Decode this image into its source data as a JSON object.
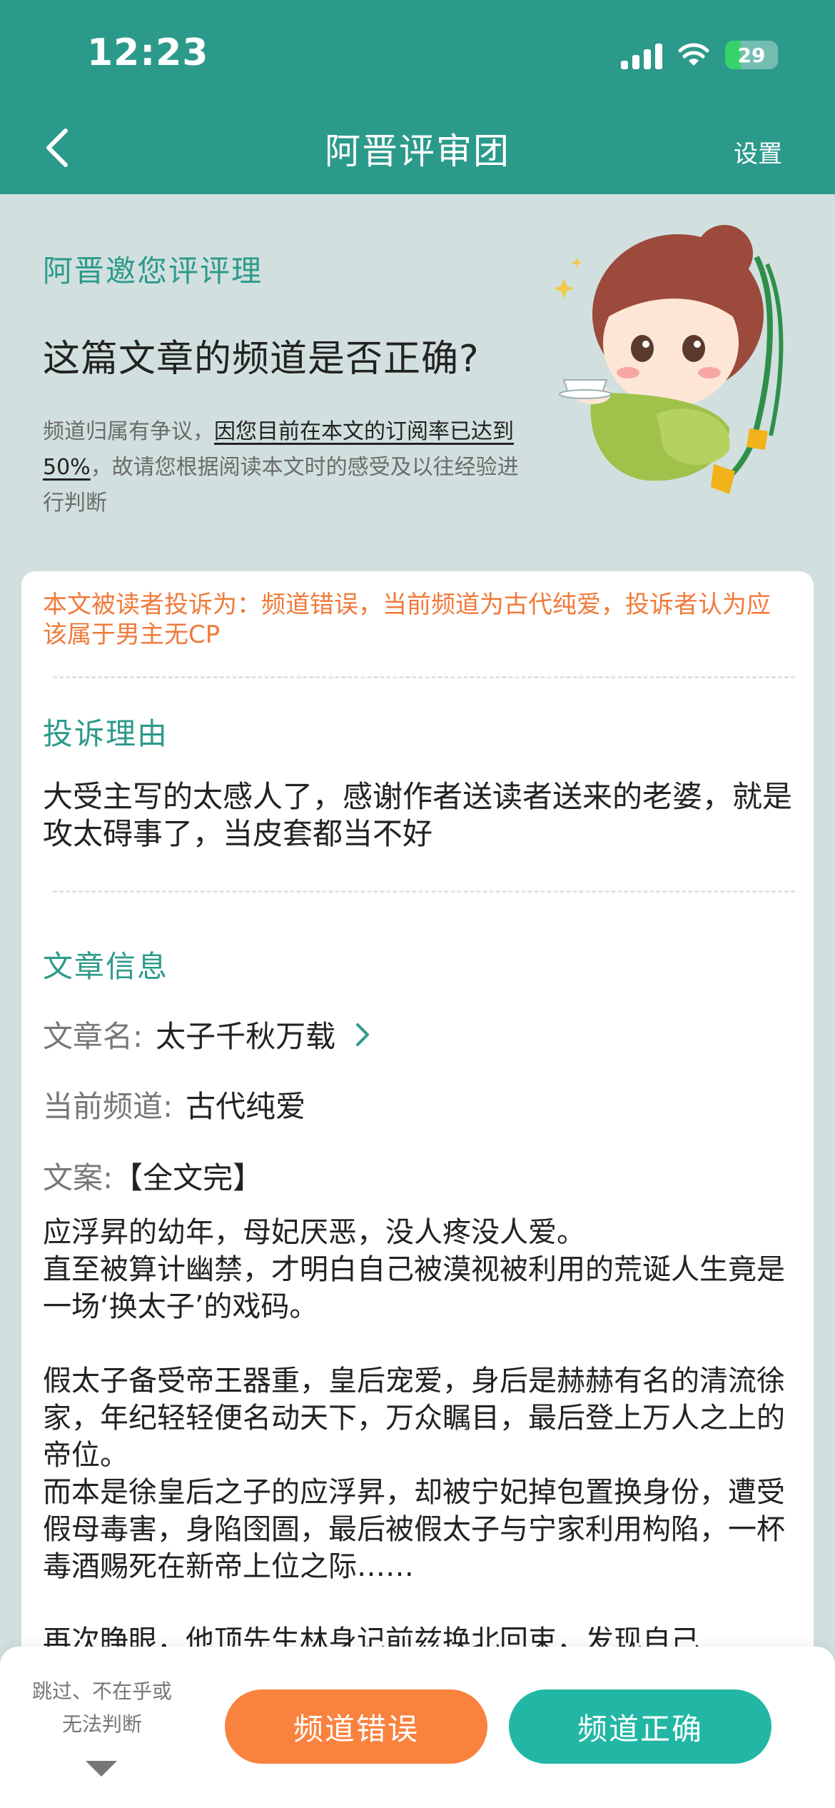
{
  "status_bar": {
    "time": "12:23",
    "battery_percent": "29"
  },
  "nav": {
    "title": "阿晋评审团",
    "settings_label": "设置"
  },
  "intro": {
    "invite_label": "阿晋邀您评评理",
    "question": "这篇文章的频道是否正确?",
    "desc_prefix": "频道归属有争议，",
    "desc_underlined": "因您目前在本文的订阅率已达到50%",
    "desc_suffix": "，故请您根据阅读本文时的感受及以往经验进行判断"
  },
  "complaint": {
    "text": "本文被读者投诉为：频道错误，当前频道为古代纯爱，投诉者认为应该属于男主无CP"
  },
  "reason_section": {
    "title": "投诉理由",
    "text": "大受主写的太感人了，感谢作者送读者送来的老婆，就是攻太碍事了，当皮套都当不好"
  },
  "article_section": {
    "title": "文章信息",
    "name_label": "文章名:",
    "name_value": "太子千秋万载",
    "channel_label": "当前频道:",
    "channel_value": "古代纯爱",
    "synopsis_label": "文案:",
    "synopsis_tag": "【全文完】",
    "synopsis_paragraphs": [
      "应浮昇的幼年，母妃厌恶，没人疼没人爱。",
      "直至被算计幽禁，才明白自己被漠视被利用的荒诞人生竟是一场‘换太子’的戏码。",
      "",
      "假太子备受帝王器重，皇后宠爱，身后是赫赫有名的清流徐家，年纪轻轻便名动天下，万众瞩目，最后登上万人之上的帝位。",
      "而本是徐皇后之子的应浮昇，却被宁妃掉包置换身份，遭受假母毒害，身陷囹圄，最后被假太子与宁家利用构陷，一杯毒酒赐死在新帝上位之际……",
      "",
      "再次睁眼，他顶先生林身记前兹换北回束，发现自己"
    ]
  },
  "actions": {
    "skip_label": "跳过、不在乎或无法判断",
    "wrong_label": "频道错误",
    "right_label": "频道正确"
  },
  "colors": {
    "teal": "#2c9a8b",
    "orange": "#f9823f",
    "button_teal": "#22b7a4"
  }
}
